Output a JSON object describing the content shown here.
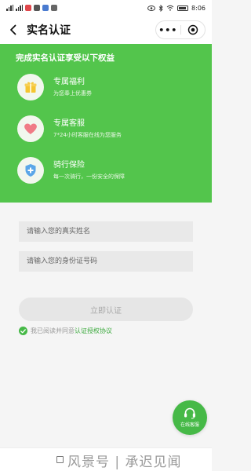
{
  "status_bar": {
    "time": "8:06"
  },
  "nav": {
    "title": "实名认证",
    "more_label": "•••"
  },
  "hero": {
    "title": "完成实名认证享受以下权益",
    "benefits": [
      {
        "title": "专属福利",
        "subtitle": "为您奉上优惠券",
        "icon": "gift-icon",
        "color": "#f4c531"
      },
      {
        "title": "专属客服",
        "subtitle": "7*24小时客服在线为您服务",
        "icon": "heart-icon",
        "color": "#f07b86"
      },
      {
        "title": "骑行保险",
        "subtitle": "每一次骑行，一份安全的保障",
        "icon": "shield-plus-icon",
        "color": "#5aa6e8"
      }
    ]
  },
  "form": {
    "name_placeholder": "请输入您的真实姓名",
    "id_placeholder": "请输入您的身份证号码",
    "submit_label": "立即认证",
    "agreement_prefix": "我已阅读并同意",
    "agreement_link": "认证授权协议"
  },
  "fab": {
    "label": "在线客服",
    "icon": "headset-icon"
  },
  "watermark": "风景号 | 承迟见闻",
  "colors": {
    "primary": "#53c54c",
    "link": "#3aa93c"
  }
}
